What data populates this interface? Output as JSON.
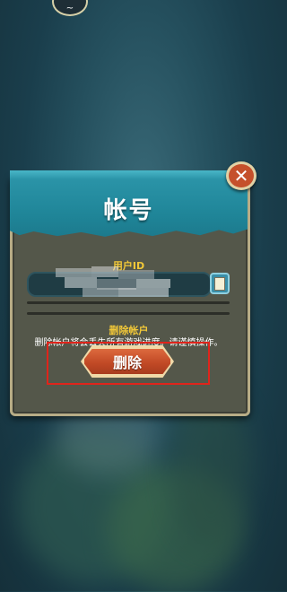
{
  "colors": {
    "banner": "#2d97ab",
    "panel": "#54574a",
    "panel_border": "#b7ac86",
    "label_yellow": "#f2c838",
    "danger_button": "#c24a26",
    "close_button": "#c5502b",
    "highlight": "#e0241b"
  },
  "top_avatar": {
    "glyph": "~"
  },
  "dialog": {
    "title": "帐号",
    "close_icon": "✕",
    "user_id_label": "用户ID",
    "user_id_value_hidden": true,
    "copy_icon": "copy-icon",
    "delete_account_label": "删除帐户",
    "warning_text": "删除帐户将会丢失所有游戏进度。请谨慎操作。",
    "delete_button_label": "删除"
  }
}
